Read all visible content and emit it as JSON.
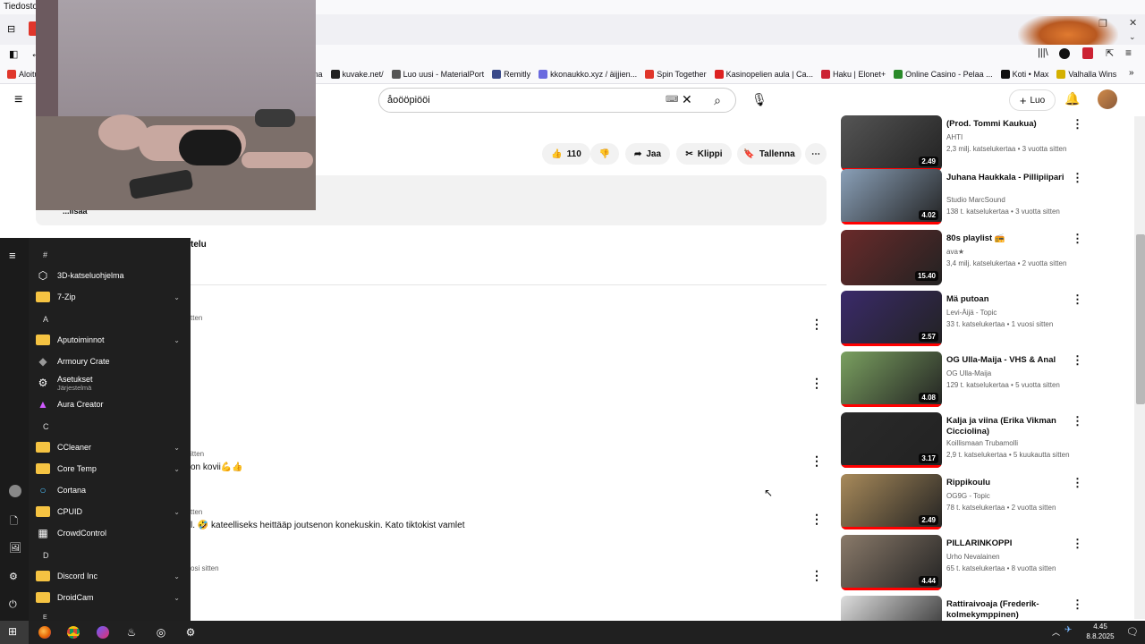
{
  "browser": {
    "menu_label": "Tiedosto",
    "bookmarks": [
      {
        "label": "Aloitu",
        "color": "#e0362b"
      },
      {
        "label": "Areena",
        "color": "#555"
      },
      {
        "label": "kuvake.net/",
        "color": "#222"
      },
      {
        "label": "Luo uusi - MaterialPort",
        "color": "#555"
      },
      {
        "label": "Remitly",
        "color": "#3a4a8a"
      },
      {
        "label": "kkonaukko.xyz / äijjien...",
        "color": "#6a6adf"
      },
      {
        "label": "Spin Together",
        "color": "#e0362b"
      },
      {
        "label": "Kasinopelien aula | Ca...",
        "color": "#d22"
      },
      {
        "label": "Haku | Elonet+",
        "color": "#c23"
      },
      {
        "label": "Online Casino - Pelaa ...",
        "color": "#2a8a2a"
      },
      {
        "label": "Koti • Max",
        "color": "#111"
      },
      {
        "label": "Valhalla Wins",
        "color": "#d4b000"
      }
    ]
  },
  "youtube": {
    "search_query": "åoööpiööi",
    "create_label": "Luo",
    "like_count": "110",
    "share_label": "Jaa",
    "clip_label": "Klippi",
    "save_label": "Tallenna",
    "show_more": "...lisää",
    "sort_label": "telu",
    "comments": [
      {
        "meta": "tten",
        "text": ""
      },
      {
        "meta": "",
        "text": ""
      },
      {
        "meta": "itten",
        "text": "on kovii💪👍"
      },
      {
        "meta": "tten",
        "text": "l. 🤣 kateelliseks heittääp joutsenon konekuskin. Kato tiktokist vamlet"
      },
      {
        "meta": "osi sitten",
        "text": ""
      }
    ]
  },
  "recommendations": [
    {
      "title": "(Prod. Tommi Kaukua)",
      "channel": "AHTI",
      "meta": "2,3 milj. katselukertaa • 3 vuotta sitten",
      "duration": "2.49",
      "progress": 1.0,
      "thumb_color": "#555"
    },
    {
      "title": "Juhana Haukkala - Pillipiipari",
      "channel": "Studio MarcSound",
      "meta": "138 t. katselukertaa • 3 vuotta sitten",
      "duration": "4.02",
      "progress": 1.0,
      "thumb_color": "#8aa0b8"
    },
    {
      "title": "80s playlist 📻",
      "channel": "ava★",
      "meta": "3,4 milj. katselukertaa • 2 vuotta sitten",
      "duration": "15.40",
      "progress": 0.0,
      "thumb_color": "#6a2a2a"
    },
    {
      "title": "Mä putoan",
      "channel": "Levi-Äijä - Topic",
      "meta": "33 t. katselukertaa • 1 vuosi sitten",
      "duration": "2.57",
      "progress": 1.0,
      "thumb_color": "#3a2a6a"
    },
    {
      "title": "OG Ulla-Maija - VHS & Anal",
      "channel": "OG Ulla-Maija",
      "meta": "129 t. katselukertaa • 5 vuotta sitten",
      "duration": "4.08",
      "progress": 1.0,
      "thumb_color": "#7aa060"
    },
    {
      "title": "Kalja ja viina (Erika Vikman Cicciolina)",
      "channel": "Koillismaan Trubamolli",
      "meta": "2,9 t. katselukertaa • 5 kuukautta sitten",
      "duration": "3.17",
      "progress": 1.0,
      "thumb_color": "#2a2a2a"
    },
    {
      "title": "Rippikoulu",
      "channel": "OG9G - Topic",
      "meta": "78 t. katselukertaa • 2 vuotta sitten",
      "duration": "2.49",
      "progress": 1.0,
      "thumb_color": "#a88a5a"
    },
    {
      "title": "PILLARINKOPPI",
      "channel": "Urho Nevalainen",
      "meta": "65 t. katselukertaa • 8 vuotta sitten",
      "duration": "4.44",
      "progress": 1.0,
      "thumb_color": "#8a7a6a"
    },
    {
      "title": "Rattiraivoaja (Frederik-kolmekymppinen)",
      "channel": "",
      "meta": "",
      "duration": "",
      "progress": 0.0,
      "thumb_color": "#ddd"
    }
  ],
  "start_menu": {
    "letters": [
      "#",
      "A",
      "C",
      "D",
      "E"
    ],
    "items": [
      {
        "label": "3D-katseluohjelma",
        "sub": "",
        "icon": "cube",
        "expand": false
      },
      {
        "label": "7-Zip",
        "sub": "",
        "icon": "folder",
        "expand": true
      },
      {
        "label": "Aputoiminnot",
        "sub": "",
        "icon": "folder",
        "expand": true
      },
      {
        "label": "Armoury Crate",
        "sub": "",
        "icon": "armoury",
        "expand": false
      },
      {
        "label": "Asetukset",
        "sub": "Järjestelmä",
        "icon": "gear",
        "expand": false
      },
      {
        "label": "Aura Creator",
        "sub": "",
        "icon": "aura",
        "expand": false
      },
      {
        "label": "CCleaner",
        "sub": "",
        "icon": "folder",
        "expand": true
      },
      {
        "label": "Core Temp",
        "sub": "",
        "icon": "folder",
        "expand": true
      },
      {
        "label": "Cortana",
        "sub": "",
        "icon": "cortana",
        "expand": false
      },
      {
        "label": "CPUID",
        "sub": "",
        "icon": "folder",
        "expand": true
      },
      {
        "label": "CrowdControl",
        "sub": "",
        "icon": "crowd",
        "expand": false
      },
      {
        "label": "Discord Inc",
        "sub": "",
        "icon": "folder",
        "expand": true
      },
      {
        "label": "DroidCam",
        "sub": "",
        "icon": "folder",
        "expand": true
      }
    ]
  },
  "taskbar": {
    "time": "4.45",
    "date": "8.8.2025"
  }
}
